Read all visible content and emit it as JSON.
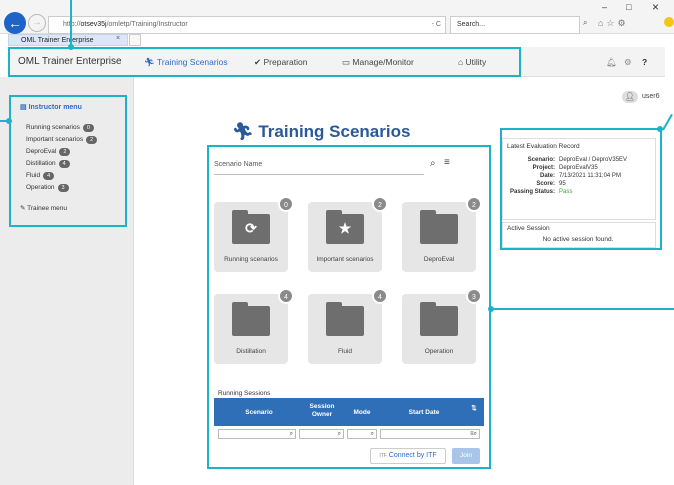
{
  "browser": {
    "url_prefix": "http://",
    "url_host": "otsev35j",
    "url_path": "/omletp/Training/Instructor",
    "refresh_symbol": "- C",
    "search_placeholder": "Search...",
    "tab_title": "OML Trainer Enterprise",
    "window_min": "–",
    "window_max": "□",
    "window_close": "×"
  },
  "nav": {
    "brand": "OML Trainer Enterprise",
    "items": [
      {
        "label": "Training Scenarios",
        "icon": "running-person-icon",
        "active": true
      },
      {
        "label": "Preparation",
        "icon": "check-circle-icon"
      },
      {
        "label": "Manage/Monitor",
        "icon": "monitor-icon"
      },
      {
        "label": "Utility",
        "icon": "bank-icon"
      }
    ]
  },
  "user": {
    "name": "user6"
  },
  "sidebar": {
    "title": "Instructor menu",
    "items": [
      {
        "label": "Running scenarios",
        "count": "0"
      },
      {
        "label": "Important scenarios",
        "count": "2"
      },
      {
        "label": "DeproEval",
        "count": "2"
      },
      {
        "label": "Distillation",
        "count": "4"
      },
      {
        "label": "Fluid",
        "count": "4"
      },
      {
        "label": "Operation",
        "count": "3"
      }
    ],
    "trainee_label": "Trainee menu"
  },
  "main": {
    "title": "Training Scenarios",
    "search_placeholder": "Scenario Name",
    "tiles": [
      {
        "label": "Running scenarios",
        "count": "0",
        "icon": "refresh-icon"
      },
      {
        "label": "Important scenarios",
        "count": "2",
        "icon": "star-icon"
      },
      {
        "label": "DeproEval",
        "count": "2",
        "icon": "folder-icon"
      },
      {
        "label": "Distillation",
        "count": "4",
        "icon": "folder-icon"
      },
      {
        "label": "Fluid",
        "count": "4",
        "icon": "folder-icon"
      },
      {
        "label": "Operation",
        "count": "3",
        "icon": "folder-icon"
      }
    ],
    "running_sessions": {
      "title": "Running Sessions",
      "columns": [
        "Scenario",
        "Session Owner",
        "Mode",
        "Start Date"
      ],
      "connect_label": "Connect by ITF",
      "join_label": "Join"
    }
  },
  "evaluation": {
    "title": "Latest Evaluation Record",
    "rows": [
      {
        "key": "Scenario:",
        "value": "DeproEval / DeproV35EV"
      },
      {
        "key": "Project:",
        "value": "DeproEvalV35"
      },
      {
        "key": "Date:",
        "value": "7/13/2021 11:31:04 PM"
      },
      {
        "key": "Score:",
        "value": "95"
      },
      {
        "key": "Passing Status:",
        "value": "Pass",
        "color": "#3aa63a"
      }
    ],
    "active_title": "Active Session",
    "active_message": "No active session found."
  },
  "colors": {
    "accent": "#2b6cc4",
    "callout": "#1ab3c8",
    "table_header": "#2f6fb8"
  }
}
